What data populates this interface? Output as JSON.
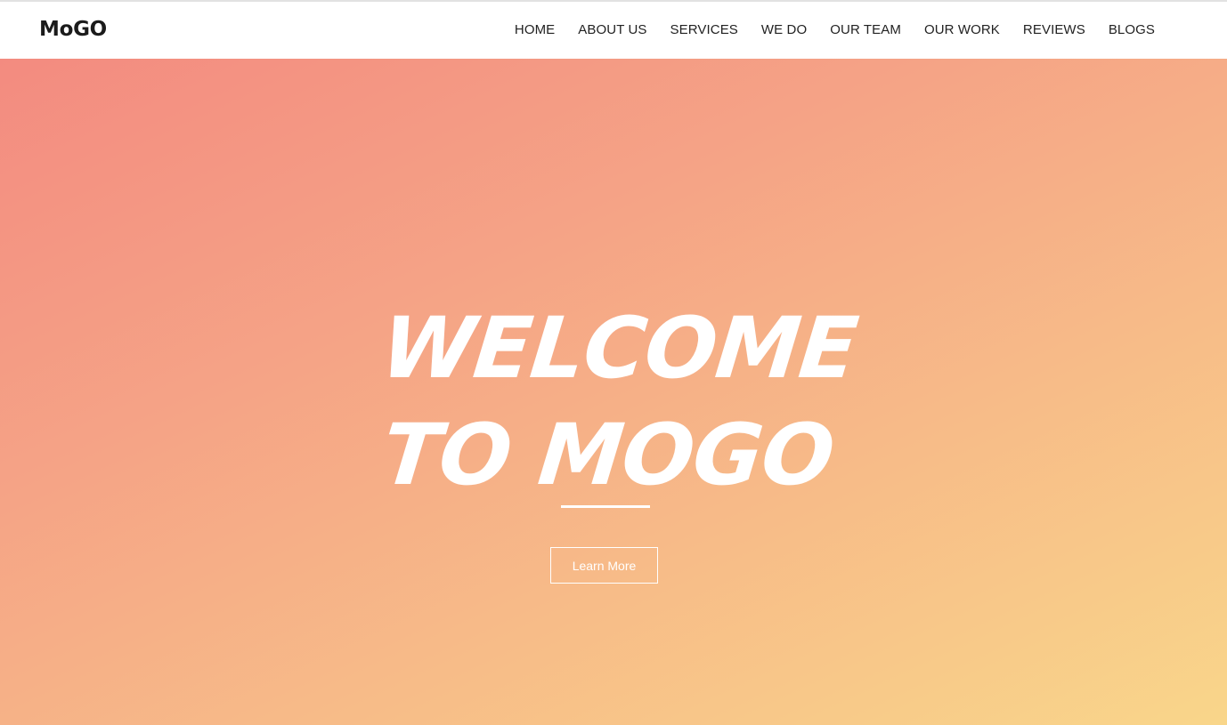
{
  "header": {
    "logo": "MoGO",
    "nav": [
      "HOME",
      "ABOUT US",
      "SERVICES",
      "WE DO",
      "OUR TEAM",
      "OUR WORK",
      "REVIEWS",
      "BLOGS"
    ]
  },
  "hero": {
    "title_line1": "WELCOME",
    "title_line2": "TO MOGO",
    "button_label": "Learn More",
    "gradient_colors": [
      "#f38b80",
      "#f5a386",
      "#f7bb88",
      "#f9d68a"
    ]
  }
}
